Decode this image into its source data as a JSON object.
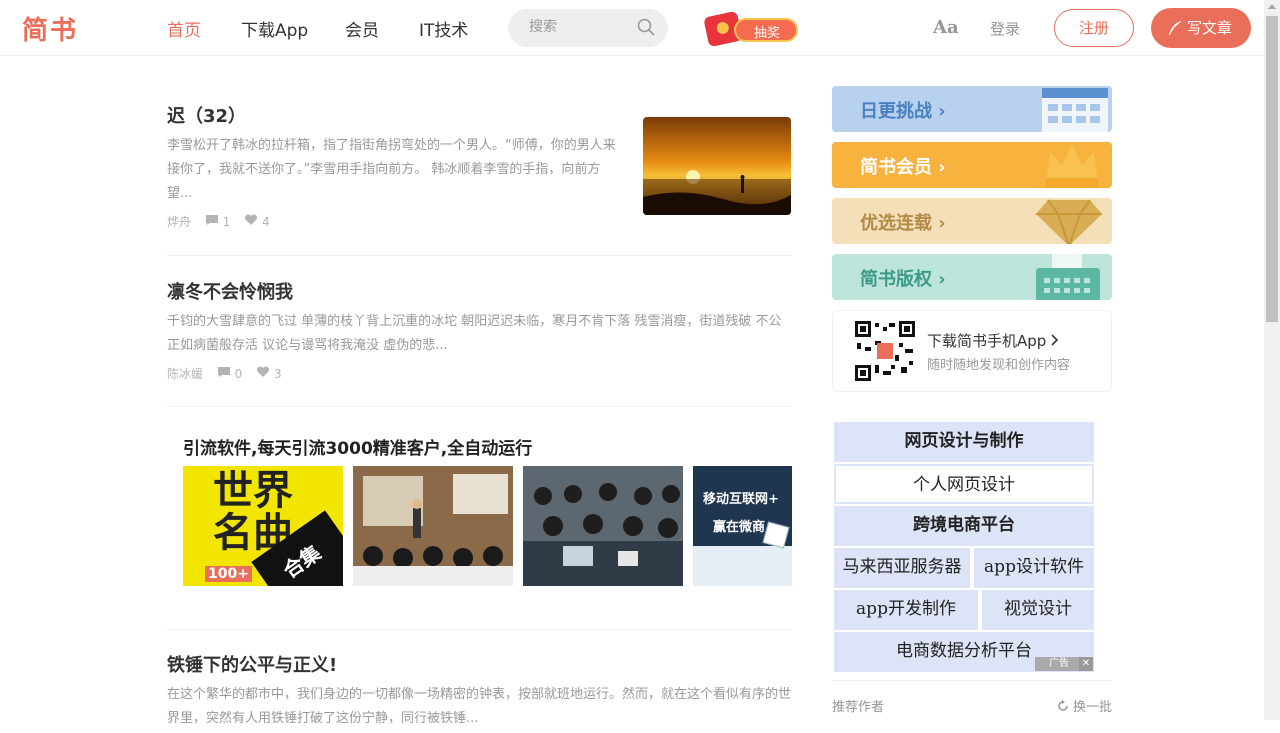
{
  "header": {
    "logo": "简书",
    "nav": [
      "首页",
      "下载App",
      "会员",
      "IT技术"
    ],
    "search_placeholder": "搜索",
    "lottery": "抽奖",
    "aa": "Aa",
    "login": "登录",
    "register": "注册",
    "write": "写文章"
  },
  "articles": [
    {
      "title": "迟（32）",
      "abstract": "李雪松开了韩冰的拉杆箱，指了指街角拐弯处的一个男人。“师傅，你的男人来接你了，我就不送你了。”李雪用手指向前方。 韩冰顺着李雪的手指，向前方望...",
      "author": "烨舟",
      "comments": "1",
      "likes": "4"
    },
    {
      "title": "凛冬不会怜悯我",
      "abstract": "千钧的大雪肆意的飞过 单薄的枝丫背上沉重的冰坨 朝阳迟迟未临，寒月不肯下落 残雪消瘦，街道残破 不公正如病菌般存活 议论与谩骂将我淹没 虚伪的悲...",
      "author": "陈冰媛",
      "comments": "0",
      "likes": "3"
    },
    {
      "title": "铁锤下的公平与正义!",
      "abstract": "在这个繁华的都市中，我们身边的一切都像一场精密的钟表，按部就班地运行。然而，就在这个看似有序的世界里，突然有人用铁锤打破了这份宁静，同行被铁锤..."
    }
  ],
  "ad": {
    "title": "引流软件,每天引流3000精准客户,全自动运行",
    "img1_line1": "世界",
    "img1_line2": "名曲",
    "img1_badge": "合集",
    "img1_count": "100+",
    "img4_line1": "移动互联网+",
    "img4_line2": "赢在微商"
  },
  "sidebar": {
    "banners": [
      {
        "label": "日更挑战 ›",
        "bg": "#b7d1ee",
        "color": "#4a80c0"
      },
      {
        "label": "简书会员 ›",
        "bg": "#f8b23e",
        "color": "#ffffff"
      },
      {
        "label": "优选连载 ›",
        "bg": "#f4dfb8",
        "color": "#b28a47"
      },
      {
        "label": "简书版权 ›",
        "bg": "#bde5dc",
        "color": "#3d9a87"
      }
    ],
    "app_title": "下载简书手机App",
    "app_sub": "随时随地发现和创作内容",
    "ad_links": [
      "网页设计与制作",
      "个人网页设计",
      "跨境电商平台",
      "马来西亚服务器",
      "app设计软件",
      "app开发制作",
      "视觉设计",
      "电商数据分析平台"
    ],
    "ad_label": "广告",
    "recommend_title": "推荐作者",
    "refresh": "换一批"
  }
}
